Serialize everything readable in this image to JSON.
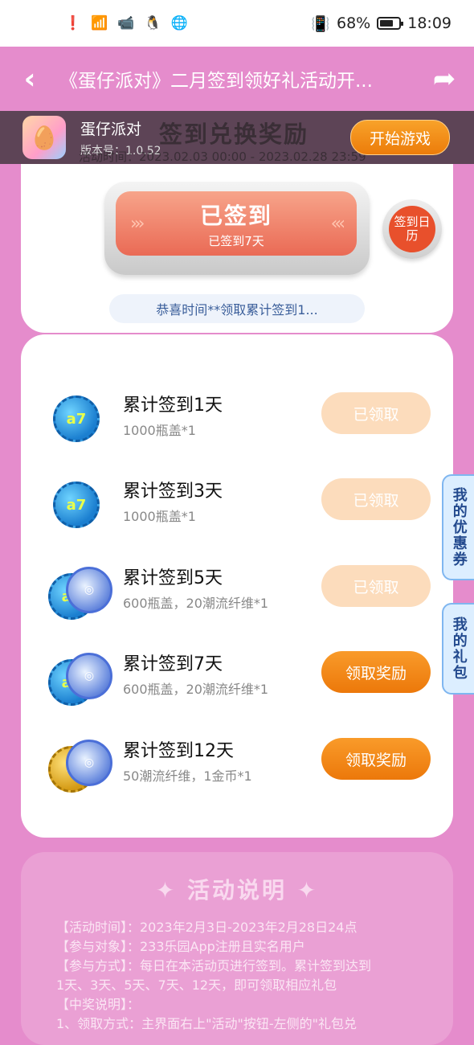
{
  "status_bar": {
    "battery": "68%",
    "time": "18:09"
  },
  "app_bar": {
    "title": "《蛋仔派对》二月签到领好礼活动开..."
  },
  "game_banner": {
    "name": "蛋仔派对",
    "version": "版本号：1.0.52",
    "bg_title": "签到兑换奖励",
    "bg_date": "活动时间：2023.02.03 00:00 - 2023.02.28 23:59",
    "start_button": "开始游戏"
  },
  "sign_in": {
    "status": "已签到",
    "days": "已签到7天",
    "calendar_label": "签到日历",
    "notice": "恭喜时间**领取累计签到1..."
  },
  "rewards": [
    {
      "title": "累计签到1天",
      "desc": "1000瓶盖*1",
      "button": "已领取",
      "state": "claimed",
      "icon": "bottle-cap-icon"
    },
    {
      "title": "累计签到3天",
      "desc": "1000瓶盖*1",
      "button": "已领取",
      "state": "claimed",
      "icon": "bottle-cap-icon"
    },
    {
      "title": "累计签到5天",
      "desc": "600瓶盖，20潮流纤维*1",
      "button": "已领取",
      "state": "claimed",
      "icon": "cap-and-fiber-icon"
    },
    {
      "title": "累计签到7天",
      "desc": "600瓶盖，20潮流纤维*1",
      "button": "领取奖励",
      "state": "active",
      "icon": "cap-and-fiber-icon"
    },
    {
      "title": "累计签到12天",
      "desc": "50潮流纤维，1金币*1",
      "button": "领取奖励",
      "state": "active",
      "icon": "coin-and-fiber-icon"
    }
  ],
  "side_tabs": {
    "coupons": "我的优惠券",
    "gifts": "我的礼包"
  },
  "description": {
    "title": "活动说明",
    "lines": [
      "【活动时间】：2023年2月3日-2023年2月28日24点",
      "【参与对象】：233乐园App注册且实名用户",
      "【参与方式】：每日在本活动页进行签到。累计签到达到",
      "1天、3天、5天、7天、12天，即可领取相应礼包",
      "【中奖说明】：",
      "1、领取方式：主界面右上\"活动\"按钮-左侧的\"礼包兑"
    ]
  },
  "colors": {
    "page_bg": "#e58ccc",
    "accent_orange": "#ec780a",
    "claimed": "#fcdcbc"
  }
}
